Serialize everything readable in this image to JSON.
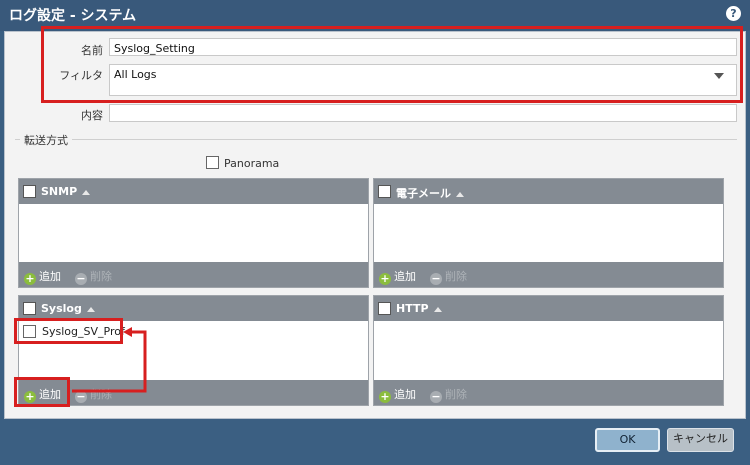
{
  "dialog": {
    "title": "ログ設定 - システム",
    "help_glyph": "?"
  },
  "form": {
    "name_label": "名前",
    "name_value": "Syslog_Setting",
    "filter_label": "フィルタ",
    "filter_value": "All Logs",
    "description_label": "内容",
    "description_value": ""
  },
  "forwarding": {
    "section_label": "転送方式",
    "panorama_label": "Panorama",
    "panels": {
      "snmp": {
        "header": "SNMP",
        "add": "追加",
        "delete": "削除",
        "rows": []
      },
      "email": {
        "header": "電子メール",
        "add": "追加",
        "delete": "削除",
        "rows": []
      },
      "syslog": {
        "header": "Syslog",
        "add": "追加",
        "delete": "削除",
        "rows": [
          "Syslog_SV_Prof"
        ]
      },
      "http": {
        "header": "HTTP",
        "add": "追加",
        "delete": "削除",
        "rows": []
      }
    }
  },
  "buttons": {
    "ok": "OK",
    "cancel": "キャンセル"
  },
  "colors": {
    "annotation_red": "#d71f1f",
    "titlebar": "#39597b",
    "panel_header": "#848b93"
  }
}
